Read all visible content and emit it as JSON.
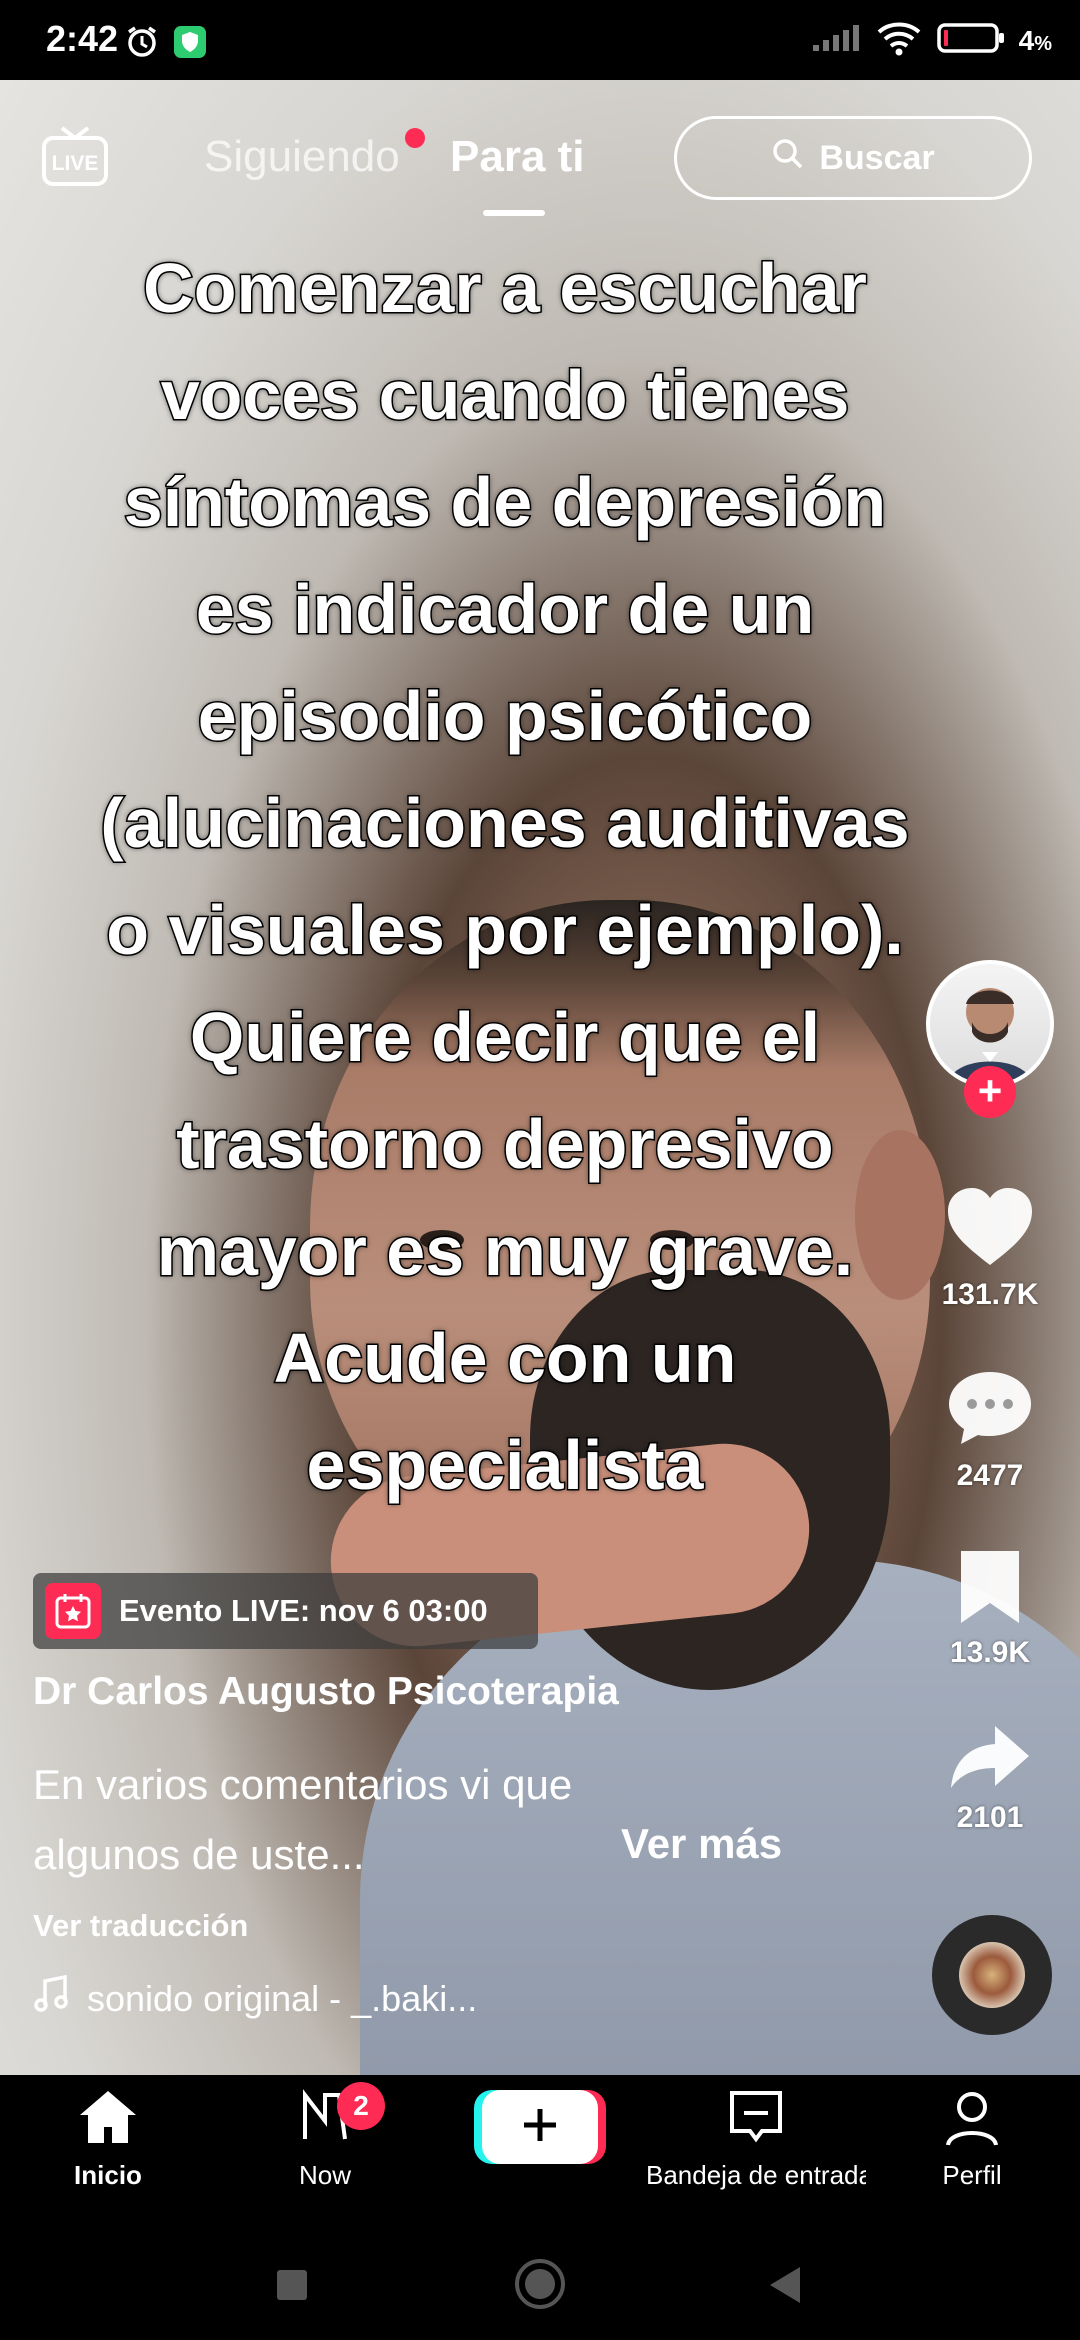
{
  "status_bar": {
    "time": "2:42",
    "battery_percent": "4",
    "battery_suffix": "%"
  },
  "top_nav": {
    "tabs": [
      {
        "label": "Siguiendo"
      },
      {
        "label": "Para ti"
      }
    ],
    "search_label": "Buscar"
  },
  "video": {
    "overlay_lines": [
      "Comenzar a escuchar",
      "voces cuando tienes",
      "síntomas de depresión",
      "es indicador de un",
      "episodio psicótico",
      "(alucinaciones auditivas",
      "o visuales por ejemplo).",
      "Quiere decir que el",
      "trastorno depresivo",
      "mayor es muy grave.",
      "Acude con un",
      "especialista"
    ]
  },
  "actions": {
    "likes": "131.7K",
    "comments": "2477",
    "saves": "13.9K",
    "shares": "2101"
  },
  "post": {
    "event_label": "Evento LIVE: nov 6 03:00",
    "username": "Dr Carlos Augusto Psicoterapia",
    "caption_line1": "En varios comentarios vi que",
    "caption_line2": "algunos de uste...",
    "see_more": "Ver más",
    "see_translation": "Ver traducción",
    "music": "sonido original - _.baki..."
  },
  "bottom_nav": {
    "items": [
      {
        "label": "Inicio"
      },
      {
        "label": "Now"
      },
      {
        "label": "Bandeja de entrada"
      },
      {
        "label": "Perfil"
      }
    ],
    "now_badge": "2"
  },
  "colors": {
    "accent": "#fe2c55",
    "cyan": "#25f4ee"
  }
}
